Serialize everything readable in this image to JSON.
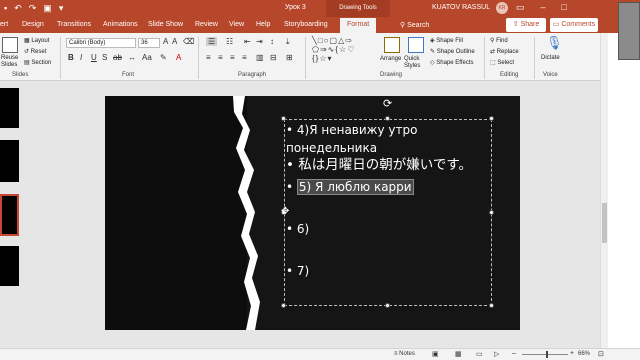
{
  "titlebar": {
    "title": "Урок 3",
    "context_tool": "Drawing Tools",
    "user": "KUATOV RASSUL",
    "initials": "KR"
  },
  "tabs": [
    {
      "label": "ert"
    },
    {
      "label": "Design"
    },
    {
      "label": "Transitions"
    },
    {
      "label": "Animations"
    },
    {
      "label": "Slide Show"
    },
    {
      "label": "Review"
    },
    {
      "label": "View"
    },
    {
      "label": "Help"
    },
    {
      "label": "Storyboarding"
    },
    {
      "label": "Format"
    }
  ],
  "search_label": "Search",
  "share_label": "Share",
  "comments_label": "Comments",
  "ribbon": {
    "slides": {
      "reuse": "Reuse Slides",
      "layout": "Layout",
      "reset": "Reset",
      "section": "Section",
      "label": "Slides"
    },
    "font": {
      "name": "Calibri (Body)",
      "size": "36",
      "label": "Font"
    },
    "paragraph": {
      "label": "Paragraph"
    },
    "drawing": {
      "arrange": "Arrange",
      "quick_styles": "Quick Styles",
      "shape_fill": "Shape Fill",
      "shape_outline": "Shape Outline",
      "shape_effects": "Shape Effects",
      "label": "Drawing"
    },
    "editing": {
      "find": "Find",
      "replace": "Replace",
      "select": "Select",
      "label": "Editing"
    },
    "voice": {
      "dictate": "Dictate",
      "label": "Voice"
    }
  },
  "slide": {
    "line1": "4)Я ненавижу утро понедельника",
    "line2": "私は月曜日の朝が嫌いです。",
    "line3": "5) Я люблю карри",
    "line4": "6)",
    "line5": "7)"
  },
  "status": {
    "notes": "Notes",
    "zoom": "66%"
  },
  "colors": {
    "accent": "#b7472a",
    "slide_bg": "#151515"
  }
}
